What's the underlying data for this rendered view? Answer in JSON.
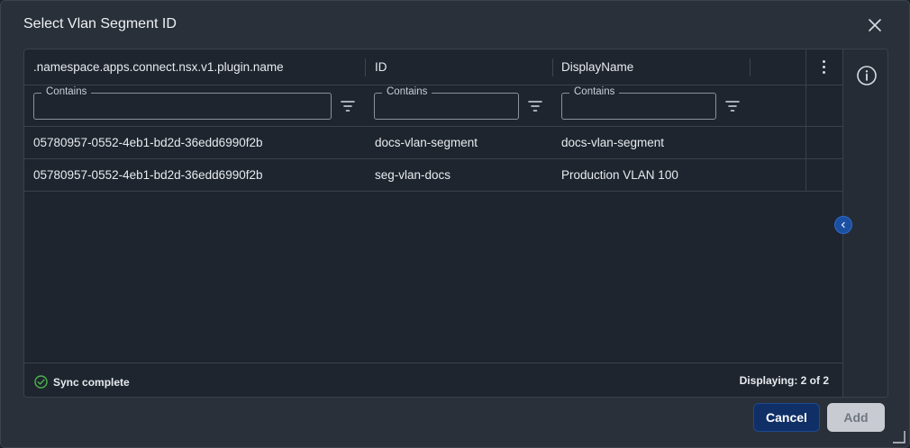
{
  "dialog": {
    "title": "Select Vlan Segment ID"
  },
  "grid": {
    "columns": [
      {
        "label": ".namespace.apps.connect.nsx.v1.plugin.name"
      },
      {
        "label": "ID"
      },
      {
        "label": "DisplayName"
      }
    ],
    "filter_label": "Contains",
    "filters": [
      {
        "label": "Contains",
        "value": ""
      },
      {
        "label": "Contains",
        "value": ""
      },
      {
        "label": "Contains",
        "value": ""
      }
    ],
    "rows": [
      {
        "name": "05780957-0552-4eb1-bd2d-36edd6990f2b",
        "id": "docs-vlan-segment",
        "display_name": "docs-vlan-segment"
      },
      {
        "name": "05780957-0552-4eb1-bd2d-36edd6990f2b",
        "id": "seg-vlan-docs",
        "display_name": "Production VLAN 100"
      }
    ]
  },
  "footer": {
    "sync_status": "Sync complete",
    "count_text": "Displaying: 2 of 2"
  },
  "buttons": {
    "cancel": "Cancel",
    "add": "Add"
  },
  "icons": {
    "close": "close-icon",
    "info": "info-icon",
    "kebab": "kebab-menu-icon",
    "filter": "filter-icon",
    "sync": "check-circle-icon",
    "collapse": "chevron-left-icon"
  },
  "colors": {
    "background": "#2a303a",
    "panel": "#1e252f",
    "primary_button": "#0f2f66",
    "disabled_button": "#c8ccd2",
    "success": "#4cb34a",
    "accent": "#1b4fa0"
  }
}
